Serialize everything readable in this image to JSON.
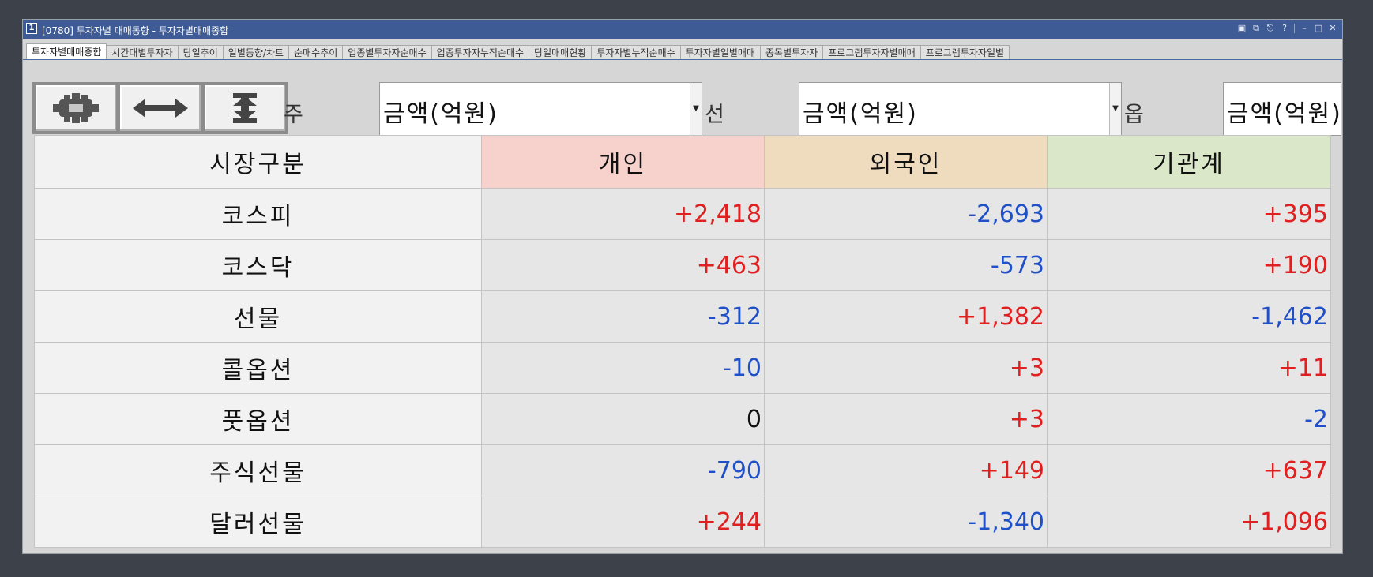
{
  "window": {
    "title": "[0780] 투자자별 매매동향 - 투자자별매매종합",
    "icon_label": "1"
  },
  "tabs": [
    {
      "label": "투자자별매매종합",
      "active": true
    },
    {
      "label": "시간대별투자자",
      "active": false
    },
    {
      "label": "당일추이",
      "active": false
    },
    {
      "label": "일별동향/차트",
      "active": false
    },
    {
      "label": "순매수추이",
      "active": false
    },
    {
      "label": "업종별투자자순매수",
      "active": false
    },
    {
      "label": "업종투자자누적순매수",
      "active": false
    },
    {
      "label": "당일매매현황",
      "active": false
    },
    {
      "label": "투자자별누적순매수",
      "active": false
    },
    {
      "label": "투자자별일별매매",
      "active": false
    },
    {
      "label": "종목별투자자",
      "active": false
    },
    {
      "label": "프로그램투자자별매매",
      "active": false
    },
    {
      "label": "프로그램투자자일별",
      "active": false
    }
  ],
  "toolbar": {
    "buttons": [
      {
        "icon": "gear-icon"
      },
      {
        "icon": "horizontal-resize-icon"
      },
      {
        "icon": "vertical-resize-icon"
      }
    ],
    "selectors": [
      {
        "label": "주",
        "value": "금액(억원)"
      },
      {
        "label": "선",
        "value": "금액(억원)"
      },
      {
        "label": "옵",
        "value": "금액(억원)"
      }
    ]
  },
  "table": {
    "headers": [
      "시장구분",
      "개인",
      "외국인",
      "기관계"
    ],
    "header_colors": [
      "#f2f2f2",
      "#f7d2cc",
      "#efdcbe",
      "#dbe7c9"
    ],
    "rows": [
      {
        "market": "코스피",
        "values": [
          "+2,418",
          "-2,693",
          "+395"
        ]
      },
      {
        "market": "코스닥",
        "values": [
          "+463",
          "-573",
          "+190"
        ]
      },
      {
        "market": "선물",
        "values": [
          "-312",
          "+1,382",
          "-1,462"
        ]
      },
      {
        "market": "콜옵션",
        "values": [
          "-10",
          "+3",
          "+11"
        ]
      },
      {
        "market": "풋옵션",
        "values": [
          "0",
          "+3",
          "-2"
        ]
      },
      {
        "market": "주식선물",
        "values": [
          "-790",
          "+149",
          "+637"
        ]
      },
      {
        "market": "달러선물",
        "values": [
          "+244",
          "-1,340",
          "+1,096"
        ]
      }
    ]
  },
  "colors": {
    "positive": "#e02020",
    "negative": "#2050c8",
    "titlebar": "#3e5b96"
  }
}
